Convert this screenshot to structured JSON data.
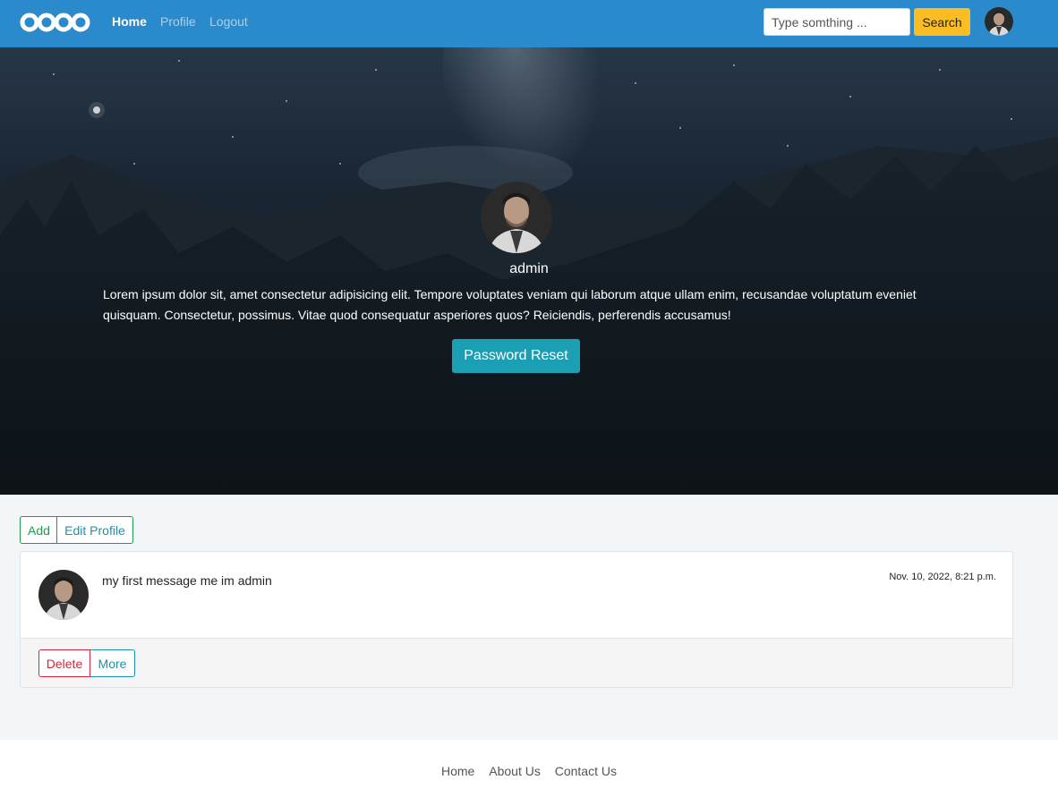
{
  "navbar": {
    "logo_icon": "oooo-logo-icon",
    "links": [
      {
        "label": "Home",
        "active": true
      },
      {
        "label": "Profile",
        "active": false
      },
      {
        "label": "Logout",
        "active": false
      }
    ],
    "search": {
      "placeholder": "Type somthing ...",
      "value": ""
    },
    "search_button": "Search",
    "search_button_color": "#fbbd23",
    "bg_color": "#2b8acb"
  },
  "profile": {
    "name": "admin",
    "bio": "Lorem ipsum dolor sit, amet consectetur adipisicing elit. Tempore voluptates veniam qui laborum atque ullam enim, recusandae voluptatum eveniet quisquam. Consectetur, possimus. Vitae quod consequatur asperiores quos? Reiciendis, perferendis accusamus!",
    "reset_button": "Password Reset",
    "reset_button_color": "#1a9fb4"
  },
  "actions": {
    "add_label": "Add",
    "edit_label": "Edit Profile"
  },
  "messages": [
    {
      "text": "my first message me im admin",
      "timestamp": "Nov. 10, 2022, 8:21 p.m.",
      "delete_label": "Delete",
      "more_label": "More"
    }
  ],
  "footer": {
    "links": [
      "Home",
      "About Us",
      "Contact Us"
    ]
  }
}
